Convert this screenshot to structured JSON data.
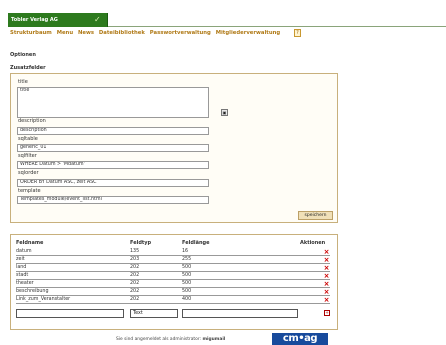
{
  "app": {
    "brand": "Tobler Verlag AG",
    "menu": [
      "Strukturbaum",
      "Menu",
      "News",
      "Dateibibliothek",
      "Passwortverwaltung",
      "Mitgliederverwaltung"
    ]
  },
  "sections": {
    "options": "Optionen",
    "extra_fields": "Zusatzfelder"
  },
  "form": {
    "fields": [
      {
        "label": "title",
        "value": "title"
      },
      {
        "label": "description",
        "value": "description"
      },
      {
        "label": "sqltable",
        "value": "generic_01"
      },
      {
        "label": "sqlfilter",
        "value": "WHERE Datum > 'Mdatum'"
      },
      {
        "label": "sqlorder",
        "value": "ORDER BY Datum ASC, zeit ASC"
      },
      {
        "label": "template",
        "value": "Templates_module/event_list.html"
      }
    ],
    "save_label": "speichern"
  },
  "table": {
    "headers": [
      "Feldname",
      "Feldtyp",
      "Feldlänge",
      "Aktionen"
    ],
    "rows": [
      [
        "datum",
        "135",
        "16"
      ],
      [
        "zeit",
        "203",
        "255"
      ],
      [
        "land",
        "202",
        "500"
      ],
      [
        "stadt",
        "202",
        "500"
      ],
      [
        "theater",
        "202",
        "500"
      ],
      [
        "beschreibung",
        "202",
        "500"
      ],
      [
        "Link_zum_Veranstalter",
        "202",
        "400"
      ]
    ],
    "new_type": "Text"
  },
  "footer": {
    "text": "Sie sind angemeldet als administrator:",
    "user": "migumail",
    "logo": "cm•ag"
  }
}
